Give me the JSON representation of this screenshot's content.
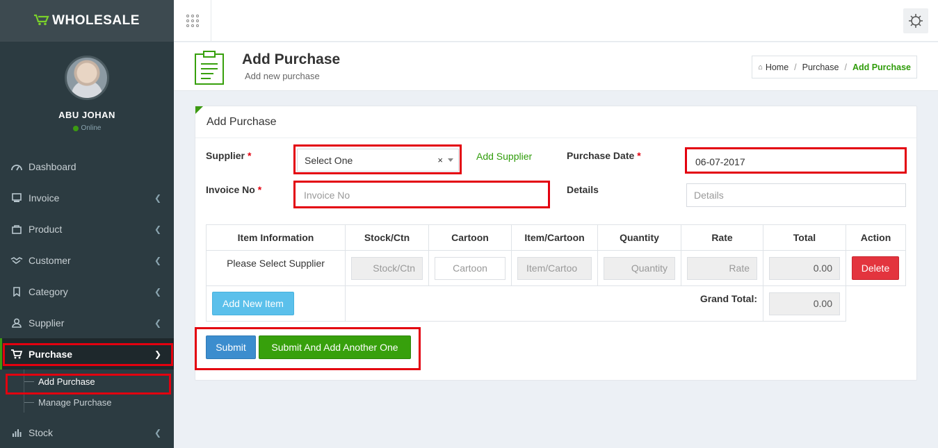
{
  "brand": {
    "name": "WHOLESALE"
  },
  "user": {
    "name": "ABU JOHAN",
    "status": "Online"
  },
  "sidebar": {
    "items": [
      {
        "label": "Dashboard",
        "icon": "dashboard-icon"
      },
      {
        "label": "Invoice",
        "icon": "invoice-icon"
      },
      {
        "label": "Product",
        "icon": "product-icon"
      },
      {
        "label": "Customer",
        "icon": "handshake-icon"
      },
      {
        "label": "Category",
        "icon": "bookmark-icon"
      },
      {
        "label": "Supplier",
        "icon": "user-icon"
      },
      {
        "label": "Purchase",
        "icon": "cart-icon"
      },
      {
        "label": "Stock",
        "icon": "bar-chart-icon"
      }
    ],
    "purchase_sub": [
      "Add Purchase",
      "Manage Purchase"
    ]
  },
  "header": {
    "title": "Add Purchase",
    "subtitle": "Add new purchase",
    "breadcrumb": [
      "Home",
      "Purchase",
      "Add Purchase"
    ]
  },
  "form": {
    "panel_title": "Add Purchase",
    "supplier_label": "Supplier",
    "supplier_value": "Select One",
    "add_supplier": "Add Supplier",
    "purchase_date_label": "Purchase Date",
    "purchase_date_value": "06-07-2017",
    "invoice_label": "Invoice No",
    "invoice_placeholder": "Invoice No",
    "details_label": "Details",
    "details_placeholder": "Details",
    "required_mark": "*"
  },
  "table": {
    "headers": [
      "Item Information",
      "Stock/Ctn",
      "Cartoon",
      "Item/Cartoon",
      "Quantity",
      "Rate",
      "Total",
      "Action"
    ],
    "row": {
      "item": "Please Select Supplier",
      "stock_placeholder": "Stock/Ctn",
      "cartoon_placeholder": "Cartoon",
      "item_cartoon_placeholder": "Item/Cartoo",
      "quantity_placeholder": "Quantity",
      "rate_placeholder": "Rate",
      "total": "0.00",
      "delete_label": "Delete"
    },
    "add_item_label": "Add New Item",
    "grand_total_label": "Grand Total:",
    "grand_total_value": "0.00"
  },
  "actions": {
    "submit": "Submit",
    "submit_another": "Submit And Add Another One"
  },
  "colors": {
    "sidebar": "#2c3b41",
    "accent_green": "#37a00c",
    "highlight_red": "#e3000f",
    "submit_blue": "#3c8dce",
    "delete_red": "#e3343e"
  }
}
